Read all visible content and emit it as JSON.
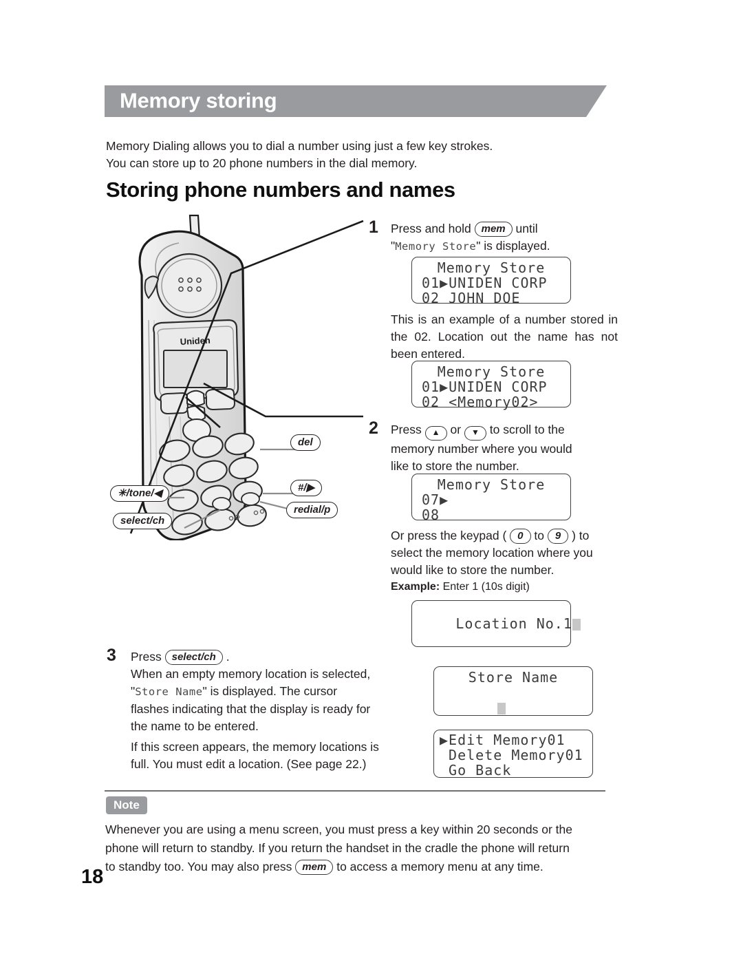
{
  "header": {
    "title": "Memory storing",
    "banner_color": "#9a9b9f"
  },
  "intro": {
    "line1": "Memory Dialing allows you to dial a number using just a few key strokes.",
    "line2": "You can store up to 20 phone numbers in the dial memory."
  },
  "section_title": "Storing phone numbers and names",
  "phone": {
    "brand": "Uniden",
    "callouts": [
      {
        "id": "del",
        "label": "del"
      },
      {
        "id": "hash-right",
        "label": "#/▶"
      },
      {
        "id": "star-tone-left",
        "label": "✳/tone/◀"
      },
      {
        "id": "redial-p",
        "label": "redial/p"
      },
      {
        "id": "select-ch",
        "label": "select/ch"
      }
    ]
  },
  "steps": [
    {
      "number": "1",
      "text_before_key": "Press and hold",
      "key": "mem",
      "text_after_key": "until",
      "line2_prefix": "\"",
      "line2_lcd": "Memory Store",
      "line2_suffix": "\" is displayed.",
      "note_paragraph": "This is an example of a number stored in the 02. Location out the name has not been entered."
    },
    {
      "number": "2",
      "text_press": "Press",
      "key_up": "▲",
      "text_or": "or",
      "key_down": "▼",
      "text_tail": "to scroll to the",
      "line2": "memory number where you would",
      "line3": "like to store the number.",
      "keypad_line1_a": "Or press the keypad (",
      "keypad_key_0": "0",
      "keypad_to": "to",
      "keypad_key_9": "9",
      "keypad_line1_b": ") to",
      "keypad_line2": "select the memory location where you",
      "keypad_line3": "would like to store the number.",
      "example_label": "Example:",
      "example_value": "Enter 1 (10s digit)"
    },
    {
      "number": "3",
      "text_press": "Press",
      "key": "select/ch",
      "text_period": ".",
      "line2": "When an empty memory location is selected,",
      "line3_prefix": "\"",
      "line3_lcd": "Store Name",
      "line3_suffix": "\" is displayed. The cursor",
      "line4": "flashes indicating that the display is ready for",
      "line5": "the name to be entered.",
      "para2_line1": "If this screen appears, the memory locations is",
      "para2_line2": "full. You must edit a location. (See page 22.)"
    }
  ],
  "lcd_screens": [
    {
      "id": "lcd-memory-store-uniden-john",
      "rows": [
        "Memory Store",
        "01▶UNIDEN CORP",
        "02 JOHN DOE"
      ]
    },
    {
      "id": "lcd-memory-store-uniden-memory02",
      "rows": [
        "Memory Store",
        "01▶UNIDEN CORP",
        "02 <Memory02>"
      ]
    },
    {
      "id": "lcd-memory-store-07-08",
      "rows": [
        "Memory Store",
        "07▶",
        "08"
      ]
    },
    {
      "id": "lcd-location-no",
      "rows": [
        "Location No.1"
      ]
    },
    {
      "id": "lcd-store-name",
      "rows": [
        "Store Name",
        ""
      ]
    },
    {
      "id": "lcd-edit-delete-goback",
      "rows": [
        "▶Edit Memory01",
        " Delete Memory01",
        " Go Back"
      ]
    }
  ],
  "note": {
    "badge": "Note",
    "line1": "Whenever you are using a menu screen, you must press a key within 20 seconds or the",
    "line2": "phone will return to standby. If you return the handset in the cradle the phone will return",
    "line3_a": "to standby too. You may also press",
    "line3_key": "mem",
    "line3_b": "to access a memory menu at any time."
  },
  "page_number": "18"
}
